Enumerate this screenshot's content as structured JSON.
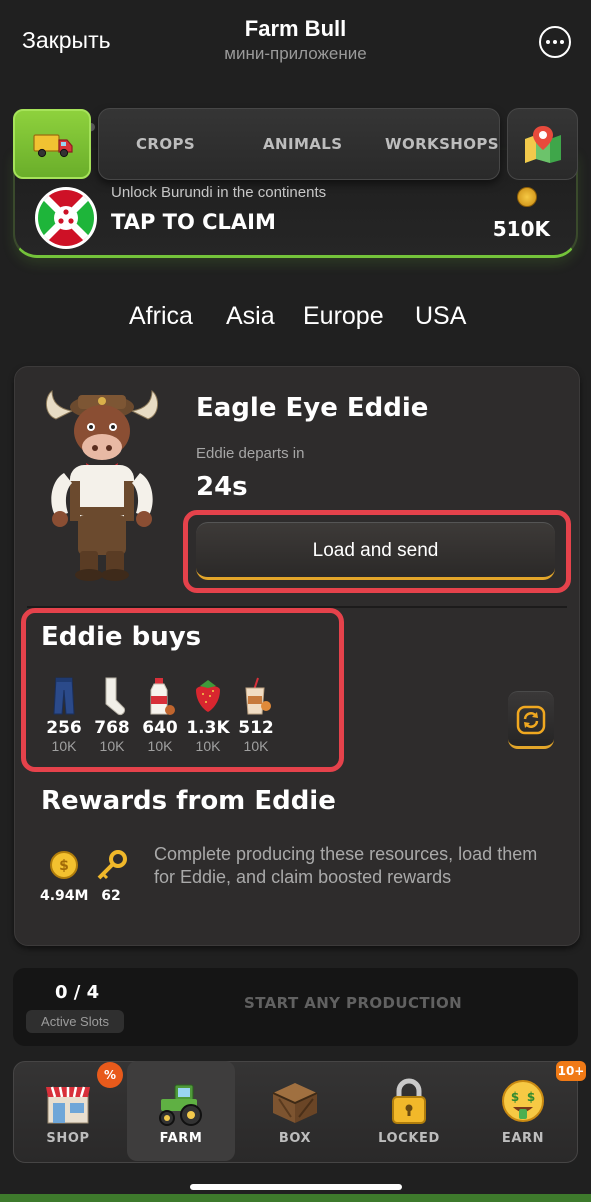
{
  "header": {
    "close_label": "Закрыть",
    "title": "Farm Bull",
    "subtitle": "мини-приложение",
    "more_icon": "ellipsis-circle-icon"
  },
  "top_tabs": {
    "truck_icon": "truck-icon",
    "items": [
      {
        "label": "CROPS"
      },
      {
        "label": "ANIMALS"
      },
      {
        "label": "WORKSHOPS"
      }
    ],
    "map_icon": "map-pin-icon"
  },
  "claim_banner": {
    "subtitle": "Unlock Burundi in the continents",
    "action": "TAP TO CLAIM",
    "reward_value": "510K",
    "flag_icon": "burundi-flag-icon",
    "accent_color": "#74c33a"
  },
  "continents": [
    "Africa",
    "Asia",
    "Europe",
    "USA"
  ],
  "npc": {
    "name": "Eagle Eye Eddie",
    "departs_label": "Eddie departs in",
    "timer": "24s",
    "load_button": "Load and send"
  },
  "buys": {
    "title": "Eddie buys",
    "items": [
      {
        "icon": "jeans-icon",
        "qty": "256",
        "target": "10K"
      },
      {
        "icon": "sock-icon",
        "qty": "768",
        "target": "10K"
      },
      {
        "icon": "milk-bottle-icon",
        "qty": "640",
        "target": "10K"
      },
      {
        "icon": "strawberry-icon",
        "qty": "1.3K",
        "target": "10K"
      },
      {
        "icon": "milkshake-icon",
        "qty": "512",
        "target": "10K"
      }
    ]
  },
  "rewards": {
    "title": "Rewards from Eddie",
    "items": [
      {
        "icon": "coin-icon",
        "value": "4.94M"
      },
      {
        "icon": "key-icon",
        "value": "62"
      }
    ],
    "description": "Complete producing these resources, load them for Eddie, and claim boosted rewards"
  },
  "slots": {
    "count": "0 / 4",
    "label": "Active Slots",
    "status": "START ANY PRODUCTION"
  },
  "nav": {
    "items": [
      {
        "label": "SHOP",
        "icon": "shop-icon"
      },
      {
        "label": "FARM",
        "icon": "tractor-icon"
      },
      {
        "label": "BOX",
        "icon": "crate-icon"
      },
      {
        "label": "LOCKED",
        "icon": "padlock-icon"
      },
      {
        "label": "EARN",
        "icon": "money-face-icon"
      }
    ],
    "shop_badge": "%",
    "earn_badge": "10+"
  },
  "colors": {
    "background": "#202020",
    "highlight": "#e5424b",
    "button_accent": "#e3a62a",
    "truck_tab": "#7cc234"
  }
}
